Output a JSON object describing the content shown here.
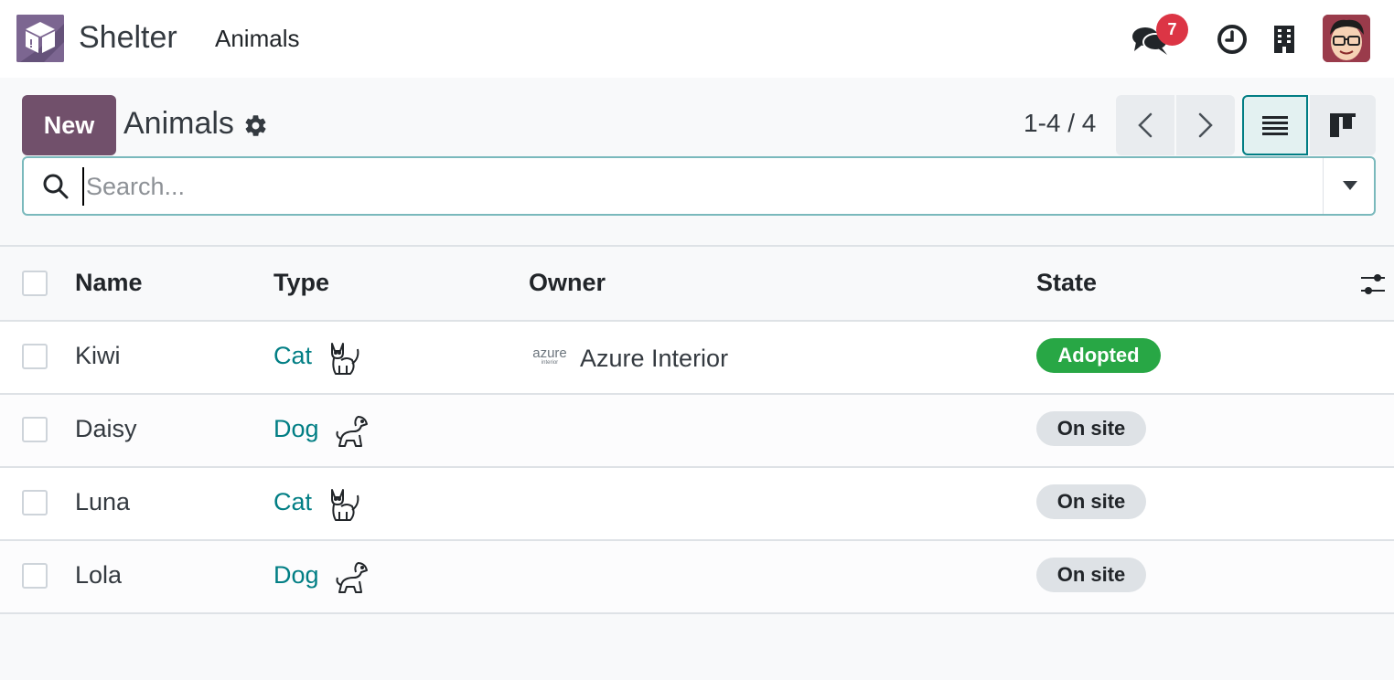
{
  "navbar": {
    "app_name": "Shelter",
    "menu_item": "Animals",
    "messages_count": "7",
    "icons": [
      "app-box-icon",
      "chat-icon",
      "clock-icon",
      "building-icon",
      "user-avatar"
    ]
  },
  "control_panel": {
    "new_label": "New",
    "title": "Animals",
    "pager": "1-4 / 4"
  },
  "search": {
    "placeholder": "Search..."
  },
  "list": {
    "columns": [
      "Name",
      "Type",
      "Owner",
      "State"
    ],
    "rows": [
      {
        "name": "Kiwi",
        "type": "Cat",
        "type_icon": "cat-icon",
        "owner": "Azure Interior",
        "owner_logo": "azure",
        "owner_logo_sub": "interior",
        "state": "Adopted"
      },
      {
        "name": "Daisy",
        "type": "Dog",
        "type_icon": "dog-icon",
        "owner": "",
        "state": "On site"
      },
      {
        "name": "Luna",
        "type": "Cat",
        "type_icon": "cat-icon",
        "owner": "",
        "state": "On site"
      },
      {
        "name": "Lola",
        "type": "Dog",
        "type_icon": "dog-icon",
        "owner": "",
        "state": "On site"
      }
    ]
  },
  "colors": {
    "brand": "#71506b",
    "accent": "#017e84",
    "adopted": "#28a745",
    "badge": "#dc3545"
  }
}
